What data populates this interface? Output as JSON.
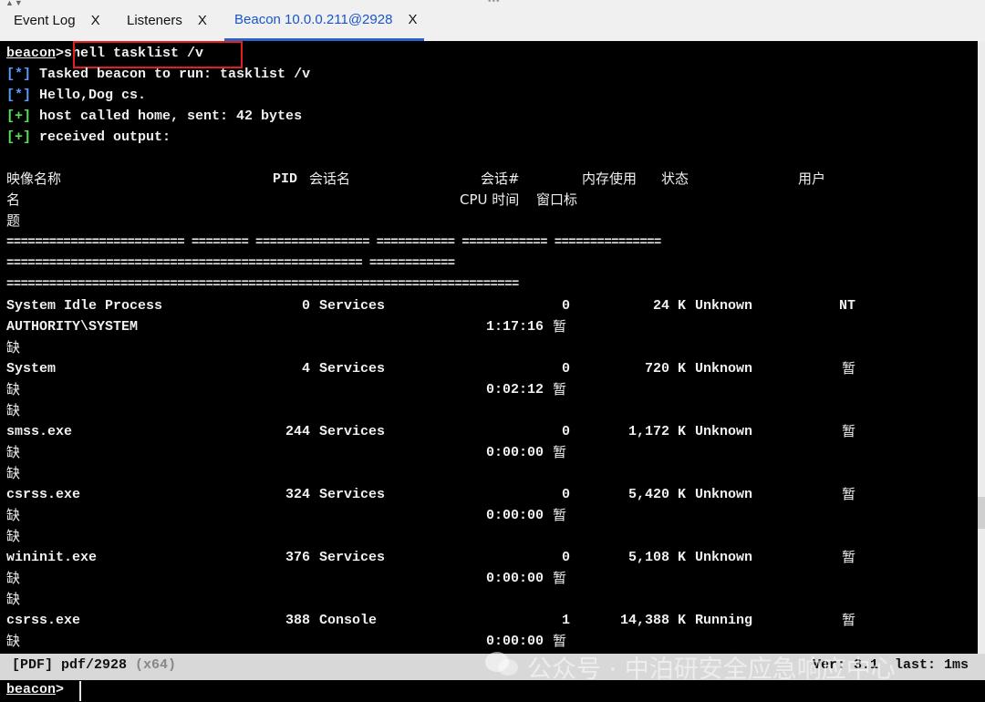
{
  "tabs": [
    {
      "label": "Event Log",
      "close": "X",
      "active": false
    },
    {
      "label": "Listeners",
      "close": "X",
      "active": false
    },
    {
      "label": "Beacon 10.0.0.211@2928",
      "close": "X",
      "active": true
    }
  ],
  "tabbar": {
    "arrows": "▲▼",
    "grip": "•••"
  },
  "console": {
    "prompt_label": "beacon",
    "prompt_sep": ">",
    "command": "shell tasklist /v",
    "lines": [
      {
        "tag": "[*]",
        "text": " Tasked beacon to run: tasklist /v"
      },
      {
        "tag": "[*]",
        "text": " Hello,Dog cs."
      },
      {
        "tag": "[+]",
        "text": " host called home, sent: 42 bytes"
      },
      {
        "tag": "[+]",
        "text": " received output:"
      }
    ],
    "header": {
      "image_name": "映像名称",
      "pid": "PID",
      "session_name": "会话名",
      "session_num": "会话#",
      "mem_usage": "内存使用",
      "status": "状态",
      "user": "用户",
      "user_cont": "名",
      "cpu_time": "CPU 时间",
      "window_title": "窗口标",
      "window_title_cont": "题"
    },
    "separators": [
      "========================= ======== ================ =========== ============ ===============",
      "================================================== ============",
      "========================================================================"
    ],
    "processes": [
      {
        "name": "System Idle Process",
        "pid": "0",
        "session": "Services",
        "sess_num": "0",
        "mem": "24 K",
        "status": "Unknown",
        "user": "NT",
        "user2": "AUTHORITY\\SYSTEM",
        "cpu": "1:17:16",
        "title": "暂",
        "title2": "缺"
      },
      {
        "name": "System",
        "pid": "4",
        "session": "Services",
        "sess_num": "0",
        "mem": "720 K",
        "status": "Unknown",
        "user": "暂",
        "user2": "缺",
        "cpu": "0:02:12",
        "title": "暂",
        "title2": "缺"
      },
      {
        "name": "smss.exe",
        "pid": "244",
        "session": "Services",
        "sess_num": "0",
        "mem": "1,172 K",
        "status": "Unknown",
        "user": "暂",
        "user2": "缺",
        "cpu": "0:00:00",
        "title": "暂",
        "title2": "缺"
      },
      {
        "name": "csrss.exe",
        "pid": "324",
        "session": "Services",
        "sess_num": "0",
        "mem": "5,420 K",
        "status": "Unknown",
        "user": "暂",
        "user2": "缺",
        "cpu": "0:00:00",
        "title": "暂",
        "title2": "缺"
      },
      {
        "name": "wininit.exe",
        "pid": "376",
        "session": "Services",
        "sess_num": "0",
        "mem": "5,108 K",
        "status": "Unknown",
        "user": "暂",
        "user2": "缺",
        "cpu": "0:00:00",
        "title": "暂",
        "title2": "缺"
      },
      {
        "name": "csrss.exe",
        "pid": "388",
        "session": "Console",
        "sess_num": "1",
        "mem": "14,388 K",
        "status": "Running",
        "user": "暂",
        "user2": "缺",
        "cpu": "0:00:00",
        "title": "暂",
        "title2": ""
      }
    ]
  },
  "statusbar": {
    "left": "[PDF] pdf/2928",
    "arch": "(x64)",
    "right": "Ver: 3.1  last: 1ms"
  },
  "watermark": "公众号 · 中泊研安全应急响应中心",
  "input_prompt": {
    "label": "beacon",
    "sep": ">"
  },
  "colors": {
    "console_bg": "#000000",
    "info_tag": "#5b9bff",
    "success_tag": "#59e05b",
    "highlight_box": "#e51f1f",
    "active_tab": "#1a55c8"
  }
}
